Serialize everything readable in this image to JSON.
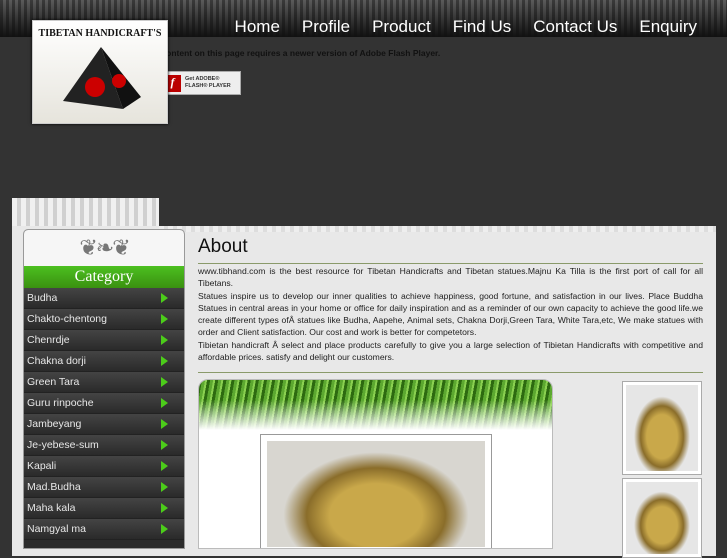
{
  "nav": [
    "Home",
    "Profile",
    "Product",
    "Find Us",
    "Contact Us",
    "Enquiry"
  ],
  "logo": {
    "text": "TIBETAN HANDICRAFT'S"
  },
  "flash": {
    "message": "Content on this page requires a newer version of Adobe Flash Player.",
    "button_line1": "Get ADOBE®",
    "button_line2": "FLASH® PLAYER"
  },
  "sidebar": {
    "title": "Category",
    "items": [
      "Budha",
      "Chakto-chentong",
      "Chenrdje",
      "Chakna dorji",
      "Green Tara",
      "Guru rinpoche",
      "Jambeyang",
      "Je-yebese-sum",
      "Kapali",
      "Mad.Budha",
      "Maha kala",
      "Namgyal ma"
    ]
  },
  "main": {
    "title": "About",
    "paragraphs": [
      "www.tibhand.com is the best resource for Tibetan Handicrafts and Tibetan statues.Majnu Ka Tilla is the first port of call for all Tibetans.",
      "Statues inspire us to develop our inner qualities to achieve happiness, good fortune, and satisfaction in our lives. Place Buddha Statues in central areas in your home or office for daily inspiration and as a reminder of our own capacity to achieve the good life.we create different types ofÂ  statues like Budha, Aapehe, Animal sets, Chakna Dorji,Green Tara, White Tara,etc, We make statues with order and Client satisfaction. Our cost and work is better for competetors.",
      "Tibietan handicraft Â select and place products carefully to give you a large selection of Tibietan Handicrafts with competitive and affordable prices. satisfy and delight our customers."
    ]
  }
}
